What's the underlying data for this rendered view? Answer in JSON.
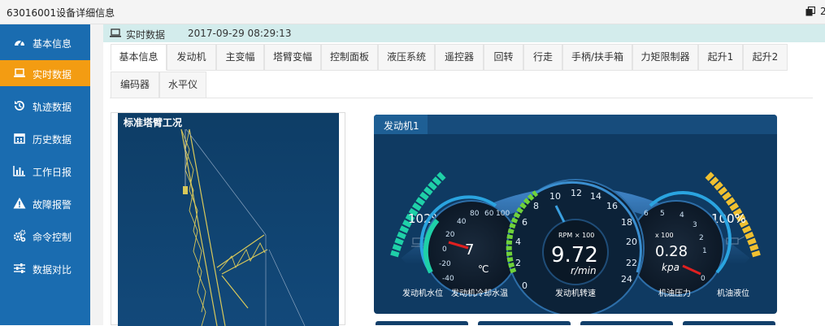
{
  "window": {
    "title": "63016001设备详细信息",
    "right_glyph": "2"
  },
  "sidebar": {
    "items": [
      {
        "label": "基本信息",
        "icon": "dashboard-icon"
      },
      {
        "label": "实时数据",
        "icon": "laptop-icon",
        "active": true
      },
      {
        "label": "轨迹数据",
        "icon": "history-icon"
      },
      {
        "label": "历史数据",
        "icon": "calendar-icon"
      },
      {
        "label": "工作日报",
        "icon": "bar-chart-icon"
      },
      {
        "label": "故障报警",
        "icon": "warning-icon"
      },
      {
        "label": "命令控制",
        "icon": "cogs-icon"
      },
      {
        "label": "数据对比",
        "icon": "sliders-icon"
      }
    ]
  },
  "realtime": {
    "label": "实时数据",
    "timestamp": "2017-09-29 08:29:13"
  },
  "tabs": [
    "基本信息",
    "发动机",
    "主变幅",
    "塔臂变幅",
    "控制面板",
    "液压系统",
    "遥控器",
    "回转",
    "行走",
    "手柄/扶手箱",
    "力矩限制器",
    "起升1",
    "起升2",
    "编码器",
    "水平仪"
  ],
  "active_tab": "基本信息",
  "crane_panel": {
    "title": "标准塔臂工况"
  },
  "engine_panel": {
    "title": "发动机1",
    "water_level": {
      "value": "102%",
      "label": "发动机水位"
    },
    "oil_level": {
      "value": "100%",
      "label": "机油液位"
    },
    "coolant_temp": {
      "value": "7",
      "unit": "℃",
      "label": "发动机冷却水温",
      "ticks": [
        "100",
        "80",
        "60",
        "40",
        "20",
        "0",
        "-20",
        "-40"
      ]
    },
    "rpm": {
      "value": "9.72",
      "unit": "r/min",
      "scale": "RPM × 100",
      "label": "发动机转速",
      "ticks": [
        "0",
        "2",
        "4",
        "6",
        "8",
        "10",
        "12",
        "14",
        "16",
        "18",
        "20",
        "22",
        "24"
      ]
    },
    "oil_pressure": {
      "value": "0.28",
      "unit": "kpa",
      "scale": "x 100",
      "label": "机油压力",
      "ticks": [
        "6",
        "5",
        "4",
        "3",
        "2",
        "1",
        "0"
      ]
    }
  }
}
